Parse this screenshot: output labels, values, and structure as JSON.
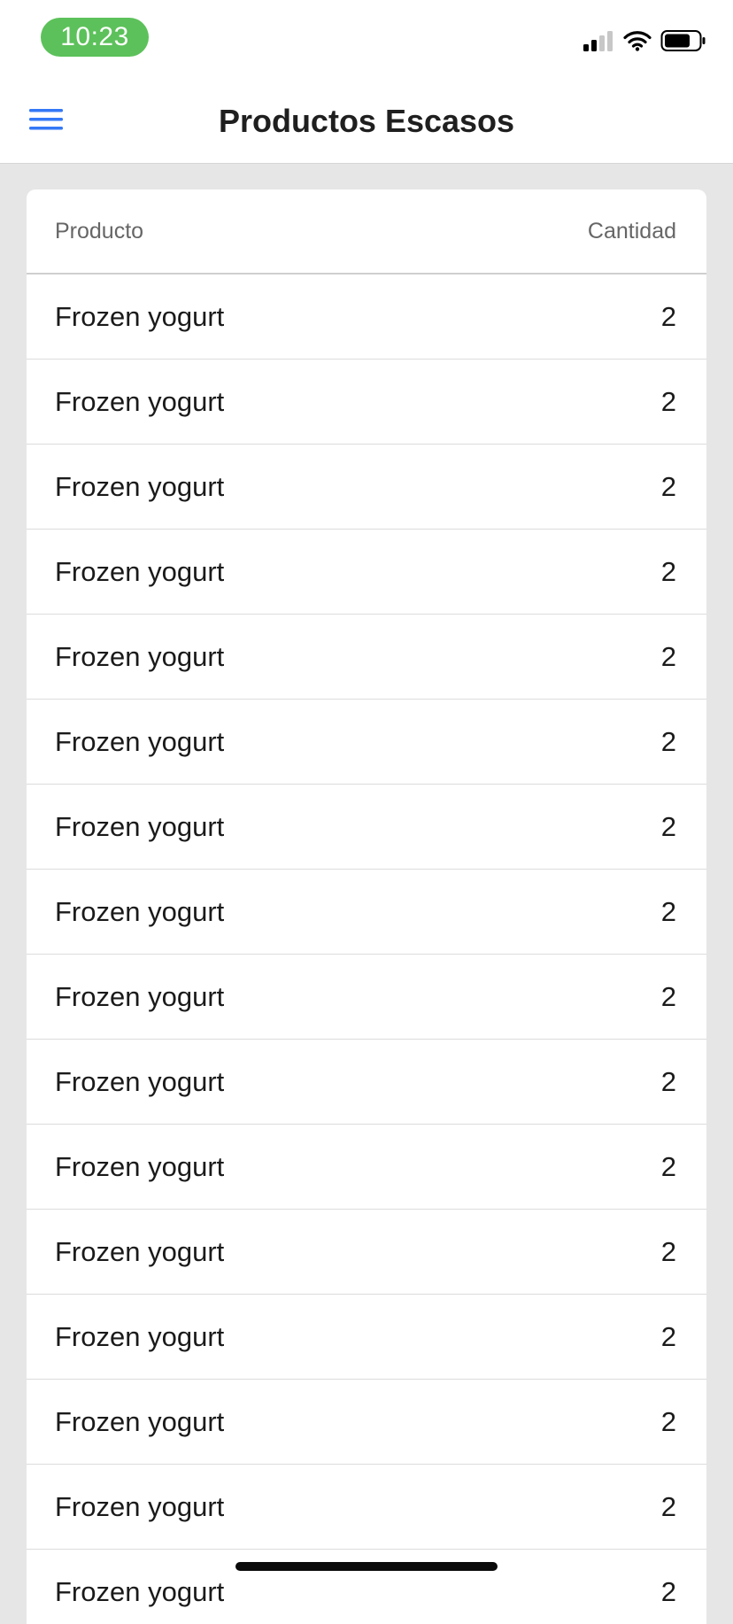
{
  "status_bar": {
    "time": "10:23",
    "icons": [
      "signal-icon",
      "wifi-icon",
      "battery-icon"
    ]
  },
  "nav": {
    "title": "Productos Escasos",
    "menu_icon": "hamburger-menu-icon",
    "accent_color": "#3478f6"
  },
  "table": {
    "columns": [
      "Producto",
      "Cantidad"
    ],
    "rows": [
      {
        "product": "Frozen yogurt",
        "quantity": "2"
      },
      {
        "product": "Frozen yogurt",
        "quantity": "2"
      },
      {
        "product": "Frozen yogurt",
        "quantity": "2"
      },
      {
        "product": "Frozen yogurt",
        "quantity": "2"
      },
      {
        "product": "Frozen yogurt",
        "quantity": "2"
      },
      {
        "product": "Frozen yogurt",
        "quantity": "2"
      },
      {
        "product": "Frozen yogurt",
        "quantity": "2"
      },
      {
        "product": "Frozen yogurt",
        "quantity": "2"
      },
      {
        "product": "Frozen yogurt",
        "quantity": "2"
      },
      {
        "product": "Frozen yogurt",
        "quantity": "2"
      },
      {
        "product": "Frozen yogurt",
        "quantity": "2"
      },
      {
        "product": "Frozen yogurt",
        "quantity": "2"
      },
      {
        "product": "Frozen yogurt",
        "quantity": "2"
      },
      {
        "product": "Frozen yogurt",
        "quantity": "2"
      },
      {
        "product": "Frozen yogurt",
        "quantity": "2"
      },
      {
        "product": "Frozen yogurt",
        "quantity": "2"
      }
    ]
  },
  "colors": {
    "status_time_pill": "#5cc15a",
    "background": "#e6e6e6"
  }
}
